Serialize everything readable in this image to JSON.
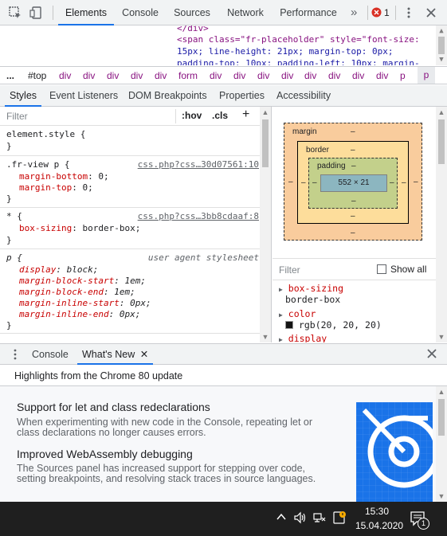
{
  "toolbar": {
    "tabs": [
      "Elements",
      "Console",
      "Sources",
      "Network",
      "Performance"
    ],
    "active_tab": "Elements",
    "more_tabs_glyph": "»",
    "error_count": "1"
  },
  "source": {
    "line1": "</div>",
    "line2": "<span class=\"fr-placeholder\" style=\"font-size:",
    "line3": "15px; line-height: 21px; margin-top: 0px;",
    "line4": "padding-top: 10px; padding-left: 10px; margin-"
  },
  "breadcrumb": {
    "ellipsis": "...",
    "items": [
      "#top",
      "div",
      "div",
      "div",
      "div",
      "div",
      "form",
      "div",
      "div",
      "div",
      "div",
      "div",
      "div",
      "div",
      "div",
      "p"
    ]
  },
  "subtabs": [
    "Styles",
    "Event Listeners",
    "DOM Breakpoints",
    "Properties",
    "Accessibility"
  ],
  "styles": {
    "filter_placeholder": "Filter",
    "hov": ":hov",
    "cls": ".cls",
    "plus": "+",
    "rules": [
      {
        "selector": "element.style {",
        "source": "",
        "decls": [],
        "close": "}"
      },
      {
        "selector": ".fr-view p {",
        "source": "css.php?css…30d07561:10",
        "decls": [
          {
            "name": "margin-bottom",
            "value": "0;"
          },
          {
            "name": "margin-top",
            "value": "0;"
          }
        ],
        "close": "}"
      },
      {
        "selector": "* {",
        "source": "css.php?css…3bb8cdaaf:8",
        "decls": [
          {
            "name": "box-sizing",
            "value": "border-box;"
          }
        ],
        "close": "}"
      },
      {
        "selector": "p {",
        "source": "user agent stylesheet",
        "decls": [
          {
            "name": "display",
            "value": "block;"
          },
          {
            "name": "margin-block-start",
            "value": "1em;"
          },
          {
            "name": "margin-block-end",
            "value": "1em;"
          },
          {
            "name": "margin-inline-start",
            "value": "0px;"
          },
          {
            "name": "margin-inline-end",
            "value": "0px;"
          }
        ],
        "close": "}"
      }
    ]
  },
  "boxmodel": {
    "margin_label": "margin",
    "border_label": "border",
    "padding_label": "padding",
    "dash": "–",
    "content": "552 × 21"
  },
  "computed": {
    "filter_placeholder": "Filter",
    "show_all": "Show all",
    "props": [
      {
        "name": "box-sizing",
        "value": "border-box"
      },
      {
        "name": "color",
        "value": "rgb(20, 20, 20)"
      },
      {
        "name": "display",
        "value": ""
      }
    ]
  },
  "drawer": {
    "tabs": [
      "Console",
      "What's New"
    ],
    "active_tab": "What's New",
    "highlights": "Highlights from the Chrome 80 update",
    "items": [
      {
        "title": "Support for let and class redeclarations",
        "desc": "When experimenting with new code in the Console, repeating let or class declarations no longer causes errors."
      },
      {
        "title": "Improved WebAssembly debugging",
        "desc": "The Sources panel has increased support for stepping over code, setting breakpoints, and resolving stack traces in source languages."
      }
    ]
  },
  "taskbar": {
    "time": "15:30",
    "date": "15.04.2020",
    "notification_count": "1"
  },
  "colors": {
    "accent": "#1a73e8",
    "tag": "#881280",
    "property": "#c80000",
    "margin_box": "#f9cc9d",
    "border_box": "#fddd9b",
    "padding_box": "#c3d08b",
    "content_box": "#8cb6c0"
  }
}
